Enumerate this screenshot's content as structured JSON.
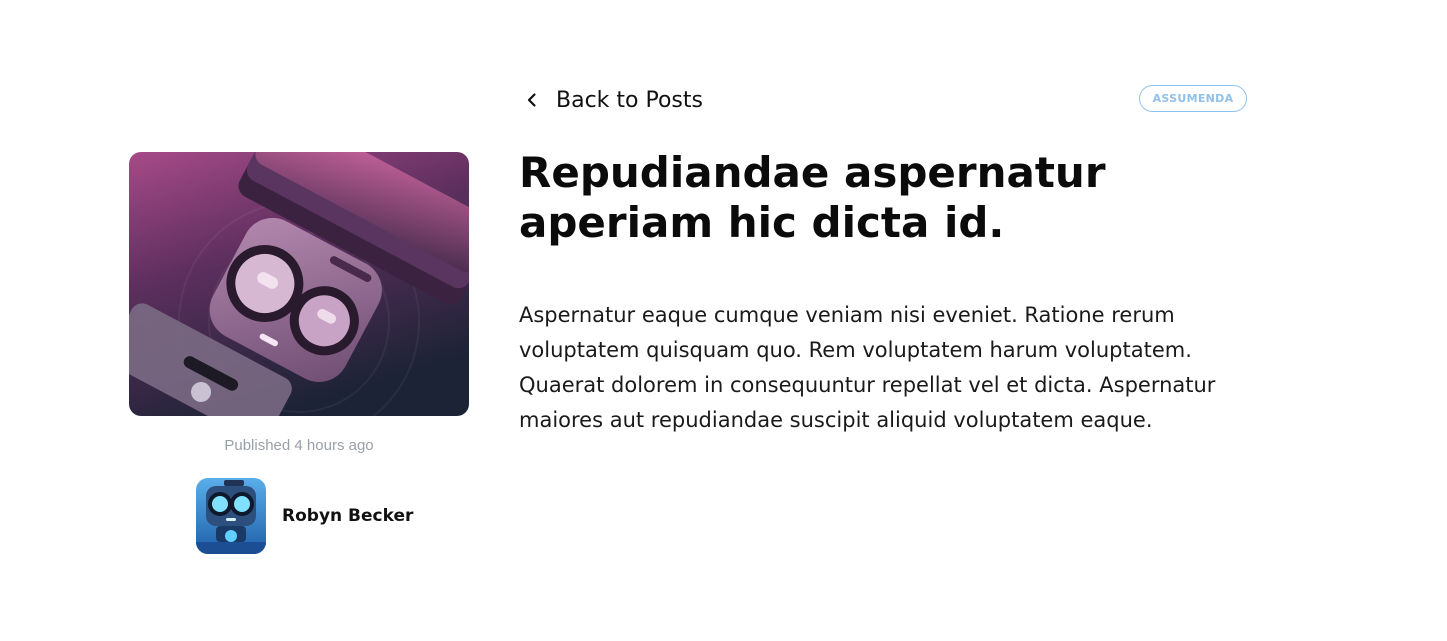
{
  "navigation": {
    "back_label": "Back to Posts",
    "back_icon": "chevron-left-icon"
  },
  "post": {
    "tag": "ASSUMENDA",
    "title": "Repudiandae aspernatur aperiam hic dicta id.",
    "body": "Aspernatur eaque cumque veniam nisi eveniet. Ratione rerum voluptatem quisquam quo. Rem voluptatem harum voluptatem. Quaerat dolorem in consequuntur repellat vel et dicta. Aspernatur maiores aut repudiandae suscipit aliquid voluptatem eaque.",
    "published": "Published 4 hours ago",
    "cover_icon": "robot-illustration"
  },
  "author": {
    "name": "Robyn Becker",
    "avatar_icon": "robot-avatar"
  },
  "colors": {
    "tag_border": "#8fc1ea",
    "meta_text": "#9aa0a8",
    "cover_top": "#b0508f",
    "cover_bottom": "#1e2538",
    "avatar_blue": "#3a8fd8"
  }
}
